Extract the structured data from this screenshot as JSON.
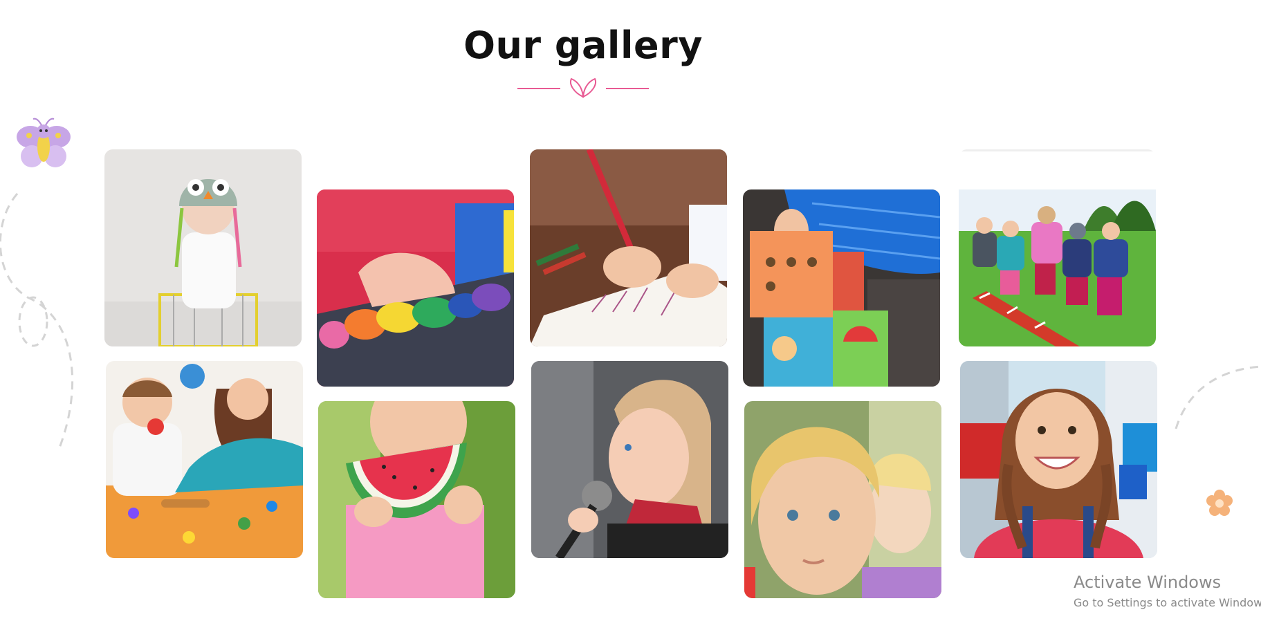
{
  "gallery": {
    "title": "Our gallery",
    "photos": [
      {
        "icon": "baby-owl-hat-photo"
      },
      {
        "icon": "play-dough-photo"
      },
      {
        "icon": "child-writing-photo"
      },
      {
        "icon": "toy-blocks-photo"
      },
      {
        "icon": "kids-running-field-photo"
      },
      {
        "icon": "teacher-playing-kids-photo"
      },
      {
        "icon": "girl-watermelon-photo"
      },
      {
        "icon": "girl-microphone-photo"
      },
      {
        "icon": "blond-boy-photo"
      },
      {
        "icon": "smiling-girl-photo"
      }
    ]
  },
  "colors": {
    "accent_pink": "#e85a93",
    "butterfly_purple": "#c7a6e6",
    "flower_orange": "#f5b27a"
  },
  "watermark": {
    "line1": "Activate Windows",
    "line2": "Go to Settings to activate Windows."
  }
}
